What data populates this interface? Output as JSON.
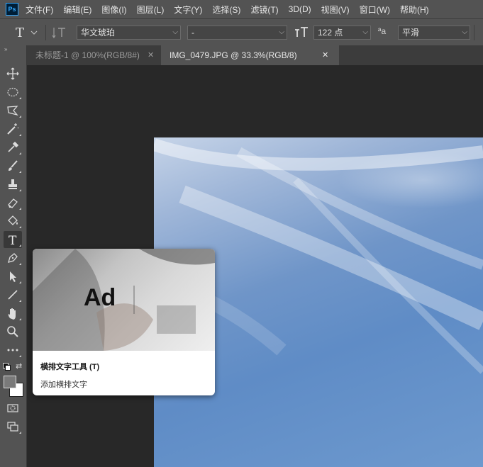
{
  "app": {
    "logo_text": "Ps"
  },
  "menu": {
    "items": [
      "文件(F)",
      "编辑(E)",
      "图像(I)",
      "图层(L)",
      "文字(Y)",
      "选择(S)",
      "滤镜(T)",
      "3D(D)",
      "视图(V)",
      "窗口(W)",
      "帮助(H)"
    ]
  },
  "options": {
    "font_family": "华文琥珀",
    "font_style": "-",
    "font_size": "122 点",
    "antialias": "平滑",
    "antialias_label": "ªa"
  },
  "tabs": [
    {
      "label": "未标题-1 @ 100%(RGB/8#)",
      "active": false
    },
    {
      "label": "IMG_0479.JPG @ 33.3%(RGB/8)",
      "active": true
    }
  ],
  "tooltip": {
    "sample_text": "Ad",
    "title": "横排文字工具 (T)",
    "description": "添加横排文字"
  },
  "colors": {
    "menubar": "#535353",
    "canvas_bg": "#282828",
    "foreground": "#7a7a7a",
    "background": "#ffffff"
  }
}
